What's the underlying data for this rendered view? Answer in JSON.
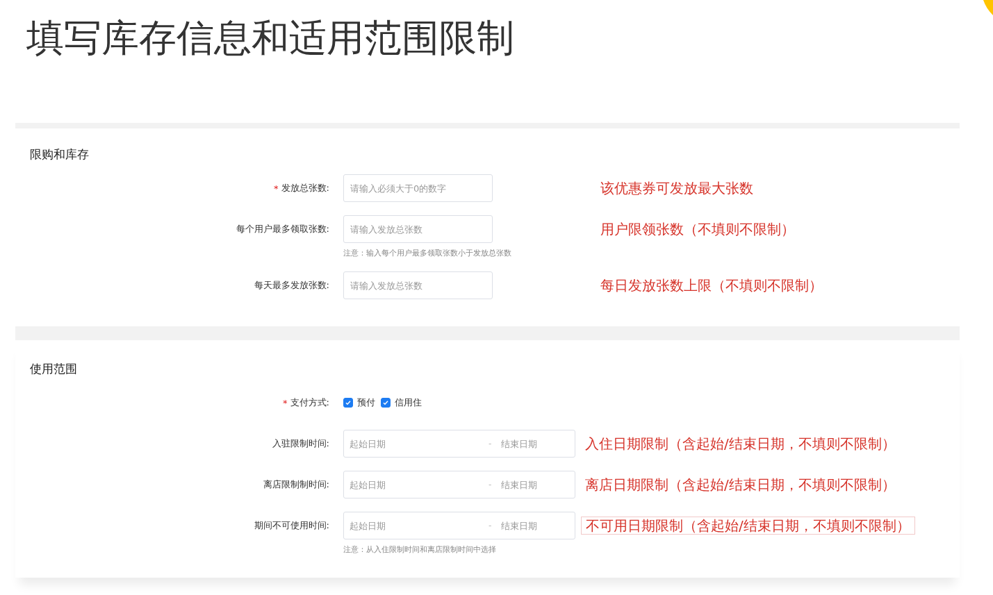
{
  "title": "填写库存信息和适用范围限制",
  "sections": [
    {
      "heading": "限购和库存",
      "rows": [
        {
          "kind": "input",
          "required_mark": "*",
          "label": "发放总张数:",
          "placeholder": "请输入必须大于0的数字",
          "annotation": {
            "text": "该优惠券可发放最大张数",
            "outlined": false
          }
        },
        {
          "kind": "input",
          "label": "每个用户最多领取张数:",
          "placeholder": "请输入发放总张数",
          "note": "注意：输入每个用户最多领取张数小于发放总张数",
          "annotation": {
            "text": "用户限领张数（不填则不限制）",
            "outlined": false
          }
        },
        {
          "kind": "input",
          "label": "每天最多发放张数:",
          "placeholder": "请输入发放总张数",
          "annotation": {
            "text": "每日发放张数上限（不填则不限制）",
            "outlined": false
          }
        }
      ]
    },
    {
      "heading": "使用范围",
      "rows": [
        {
          "kind": "checkboxes",
          "required_mark": "*",
          "label": "支付方式:",
          "options": [
            {
              "label": "预付",
              "checked": true
            },
            {
              "label": "信用住",
              "checked": true
            }
          ]
        },
        {
          "kind": "date_range",
          "label": "入驻限制时间:",
          "start_placeholder": "起始日期",
          "separator": "-",
          "end_placeholder": "结束日期",
          "annotation": {
            "text": "入住日期限制（含起始/结束日期，不填则不限制）",
            "outlined": false
          }
        },
        {
          "kind": "date_range",
          "label": "离店限制制时间:",
          "start_placeholder": "起始日期",
          "separator": "-",
          "end_placeholder": "结束日期",
          "annotation": {
            "text": "离店日期限制（含起始/结束日期，不填则不限制）",
            "outlined": false
          }
        },
        {
          "kind": "date_range",
          "label": "期间不可使用时间:",
          "start_placeholder": "起始日期",
          "separator": "-",
          "end_placeholder": "结束日期",
          "note": "注意：从入住限制时间和离店限制时间中选择",
          "annotation": {
            "text": "不可用日期限制（含起始/结束日期，不填则不限制）",
            "outlined": true
          }
        }
      ]
    }
  ]
}
